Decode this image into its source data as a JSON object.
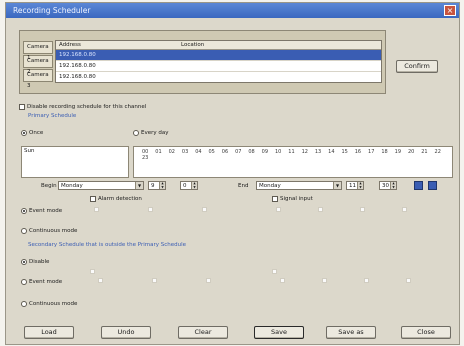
{
  "window": {
    "title": "Recording Scheduler",
    "close_glyph": "×"
  },
  "cameras": [
    "Camera 1",
    "Camera 2",
    "Camera 3"
  ],
  "table": {
    "headers": [
      "Address",
      "Location"
    ],
    "rows": [
      {
        "address": "192.168.0.80",
        "location": ""
      },
      {
        "address": "192.168.0.80",
        "location": ""
      },
      {
        "address": "192.168.0.80",
        "location": ""
      }
    ]
  },
  "confirm_label": "Confirm",
  "disable_label": "Disable recording schedule for this channel",
  "primary": {
    "section_title": "Primary Schedule",
    "once_label": "Once",
    "everyday_label": "Every day",
    "date_label": "Sun",
    "hours": [
      "00",
      "01",
      "02",
      "03",
      "04",
      "05",
      "06",
      "07",
      "08",
      "09",
      "10",
      "11",
      "12",
      "13",
      "14",
      "15",
      "16",
      "17",
      "18",
      "19",
      "20",
      "21",
      "22",
      "23"
    ],
    "begin_label": "Begin",
    "begin_day": "Monday",
    "begin_hour": "9",
    "begin_min": "0",
    "end_label": "End",
    "end_day": "Monday",
    "end_hour": "11",
    "end_min": "30",
    "alarm_label": "Alarm detection",
    "signal_label": "Signal input",
    "event_label": "Event mode",
    "continuous_label": "Continuous mode"
  },
  "secondary": {
    "section_title": "Secondary Schedule that is outside the Primary Schedule",
    "disable_label": "Disable",
    "event_label": "Event mode",
    "continuous_label": "Continuous mode"
  },
  "buttons": [
    "Load",
    "Undo",
    "Clear",
    "Save",
    "Save as",
    "Close"
  ]
}
